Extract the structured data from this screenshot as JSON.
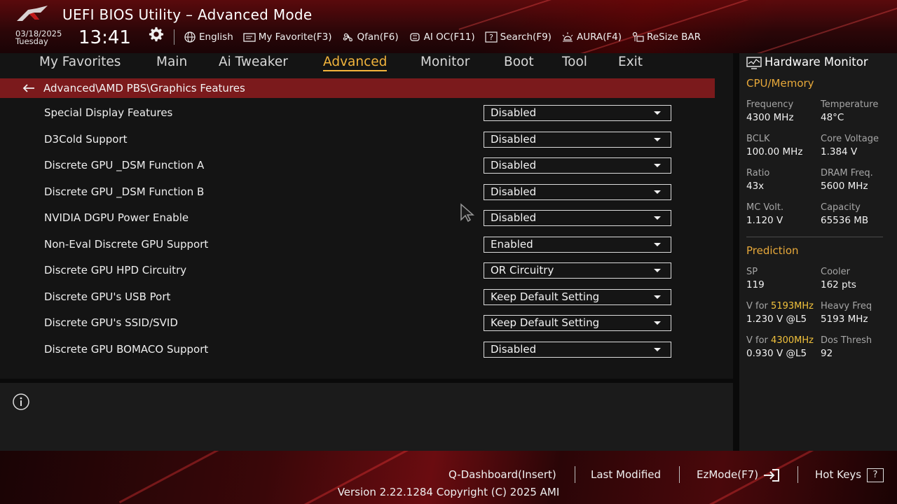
{
  "header": {
    "title": "UEFI BIOS Utility – Advanced Mode",
    "date": "03/18/2025",
    "day": "Tuesday",
    "time": "13:41",
    "toolbar": [
      {
        "label": "English",
        "icon": "globe-icon"
      },
      {
        "label": "My Favorite(F3)",
        "icon": "favorite-icon"
      },
      {
        "label": "Qfan(F6)",
        "icon": "fan-icon"
      },
      {
        "label": "AI OC(F11)",
        "icon": "ai-chip-icon"
      },
      {
        "label": "Search(F9)",
        "icon": "search-icon"
      },
      {
        "label": "AURA(F4)",
        "icon": "aura-icon"
      },
      {
        "label": "ReSize BAR",
        "icon": "resize-bar-icon"
      }
    ]
  },
  "tabs": [
    {
      "label": "My Favorites",
      "active": false
    },
    {
      "label": "Main",
      "active": false
    },
    {
      "label": "Ai Tweaker",
      "active": false
    },
    {
      "label": "Advanced",
      "active": true
    },
    {
      "label": "Monitor",
      "active": false
    },
    {
      "label": "Boot",
      "active": false
    },
    {
      "label": "Tool",
      "active": false
    },
    {
      "label": "Exit",
      "active": false
    }
  ],
  "breadcrumb": "Advanced\\AMD PBS\\Graphics Features",
  "settings": [
    {
      "label": "Special Display Features",
      "value": "Disabled"
    },
    {
      "label": "D3Cold Support",
      "value": "Disabled"
    },
    {
      "label": "Discrete GPU _DSM Function A",
      "value": "Disabled"
    },
    {
      "label": "Discrete GPU _DSM Function B",
      "value": "Disabled"
    },
    {
      "label": "NVIDIA DGPU Power Enable",
      "value": "Disabled"
    },
    {
      "label": "Non-Eval Discrete GPU Support",
      "value": "Enabled"
    },
    {
      "label": "Discrete GPU HPD Circuitry",
      "value": "OR Circuitry"
    },
    {
      "label": "Discrete GPU's USB Port",
      "value": "Keep Default Setting"
    },
    {
      "label": "Discrete GPU's SSID/SVID",
      "value": "Keep Default Setting"
    },
    {
      "label": "Discrete GPU BOMACO Support",
      "value": "Disabled"
    }
  ],
  "hardware_monitor": {
    "title": "Hardware Monitor",
    "cpu_memory": {
      "title": "CPU/Memory",
      "stats": [
        {
          "label": "Frequency",
          "value": "4300 MHz"
        },
        {
          "label": "Temperature",
          "value": "48°C"
        },
        {
          "label": "BCLK",
          "value": "100.00 MHz"
        },
        {
          "label": "Core Voltage",
          "value": "1.384 V"
        },
        {
          "label": "Ratio",
          "value": "43x"
        },
        {
          "label": "DRAM Freq.",
          "value": "5600 MHz"
        },
        {
          "label": "MC Volt.",
          "value": "1.120 V"
        },
        {
          "label": "Capacity",
          "value": "65536 MB"
        }
      ]
    },
    "prediction": {
      "title": "Prediction",
      "sp_label": "SP",
      "sp_value": "119",
      "cooler_label": "Cooler",
      "cooler_value": "162 pts",
      "v1_prefix": "V for",
      "v1_freq": "5193MHz",
      "v1_value": "1.230 V @L5",
      "heavy_label": "Heavy Freq",
      "heavy_value": "5193 MHz",
      "v2_prefix": "V for",
      "v2_freq": "4300MHz",
      "v2_value": "0.930 V @L5",
      "dos_label": "Dos Thresh",
      "dos_value": "92"
    }
  },
  "footer": {
    "qdashboard": "Q-Dashboard(Insert)",
    "last_modified": "Last Modified",
    "ezmode": "EzMode(F7)",
    "hotkeys": "Hot Keys",
    "hotkeys_glyph": "?",
    "version": "Version 2.22.1284 Copyright (C) 2025 AMI"
  },
  "colors": {
    "accent": "#f2b43c",
    "breadcrumb_bg": "#7b1a1c",
    "section_title": "#e8a93a"
  }
}
